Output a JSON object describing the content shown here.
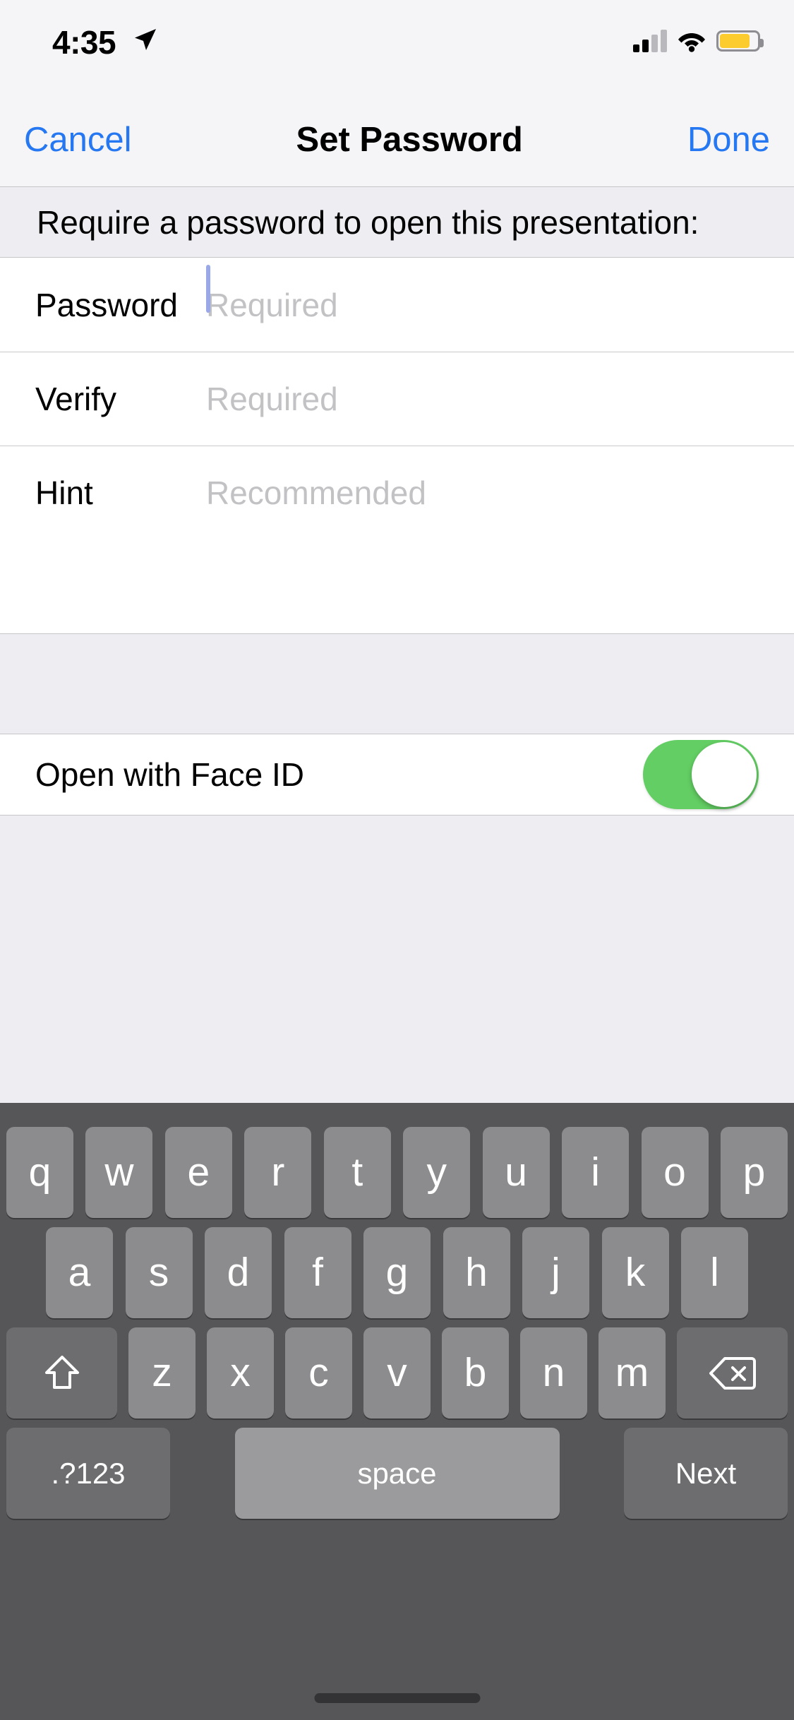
{
  "status_bar": {
    "time": "4:35",
    "location_icon": "location-arrow-icon",
    "signal_icon": "cellular-signal-icon",
    "signal_bars_filled": 2,
    "signal_bars_total": 4,
    "wifi_icon": "wifi-icon",
    "battery_icon": "battery-icon",
    "battery_color": "#fccb2e",
    "battery_level_percent": 80
  },
  "nav_bar": {
    "cancel_label": "Cancel",
    "title": "Set Password",
    "done_label": "Done",
    "tint_color": "#2577f2"
  },
  "section_header": {
    "text": "Require a password to open this presentation:"
  },
  "fields": [
    {
      "label": "Password",
      "value": "",
      "placeholder": "Required",
      "focused": true
    },
    {
      "label": "Verify",
      "value": "",
      "placeholder": "Required",
      "focused": false
    },
    {
      "label": "Hint",
      "value": "",
      "placeholder": "Recommended",
      "focused": false
    }
  ],
  "face_id_row": {
    "label": "Open with Face ID",
    "toggle_state": "on",
    "toggle_on_color": "#63ce63"
  },
  "keyboard": {
    "row1": [
      "q",
      "w",
      "e",
      "r",
      "t",
      "y",
      "u",
      "i",
      "o",
      "p"
    ],
    "row2": [
      "a",
      "s",
      "d",
      "f",
      "g",
      "h",
      "j",
      "k",
      "l"
    ],
    "row3_letters": [
      "z",
      "x",
      "c",
      "v",
      "b",
      "n",
      "m"
    ],
    "shift_icon": "shift-arrow-icon",
    "backspace_icon": "backspace-delete-icon",
    "numbers_label": ".?123",
    "space_label": "space",
    "return_label": "Next",
    "background_color": "#565659",
    "key_color": "#8c8c8e",
    "modifier_key_color": "#6d6d70"
  },
  "home_indicator": {
    "name": "home-indicator"
  }
}
